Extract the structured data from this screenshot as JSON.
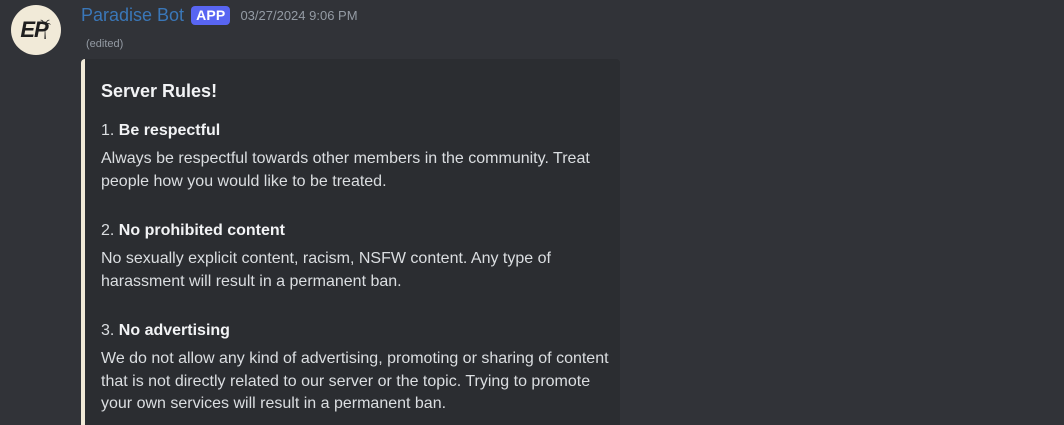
{
  "author": {
    "avatar_text": "EP",
    "username": "Paradise Bot",
    "badge": "APP",
    "timestamp": "03/27/2024 9:06 PM",
    "edited": "(edited)"
  },
  "embed": {
    "title": "Server Rules!",
    "accent_color": "#f1ead8",
    "rules": [
      {
        "number": "1.",
        "name": "Be respectful",
        "description": "Always be respectful towards other members in the community. Treat people how you would like to be treated."
      },
      {
        "number": "2.",
        "name": "No prohibited content",
        "description": "No sexually explicit content, racism, NSFW content. Any type of harassment will result in a permanent ban."
      },
      {
        "number": "3.",
        "name": "No advertising",
        "description": "We do not allow any kind of advertising, promoting or sharing of content that is not directly related to our server or the topic. Trying to promote your own services will result in a permanent ban."
      }
    ]
  }
}
